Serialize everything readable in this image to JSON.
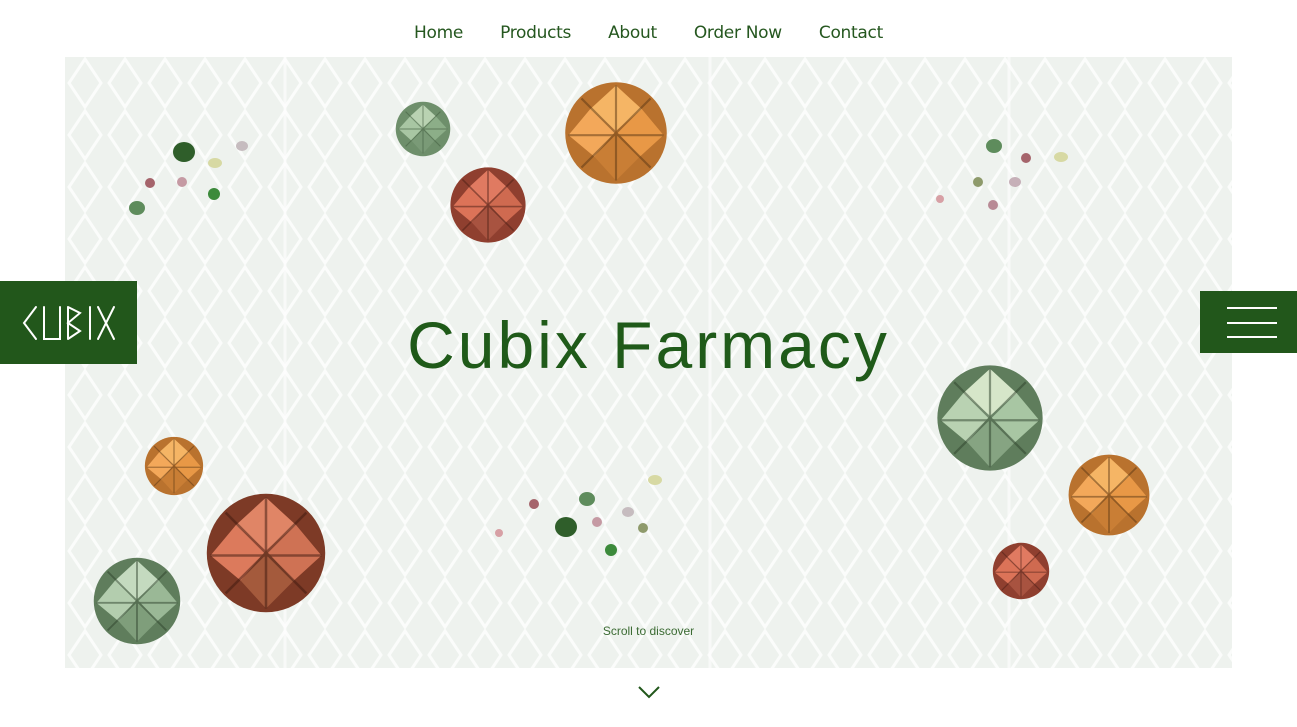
{
  "nav": {
    "items": [
      {
        "label": "Home"
      },
      {
        "label": "Products"
      },
      {
        "label": "About"
      },
      {
        "label": "Order Now"
      },
      {
        "label": "Contact"
      }
    ]
  },
  "logo": {
    "text": "CUBIX"
  },
  "hero": {
    "title": "Cubix Farmacy",
    "scroll_hint": "Scroll to discover"
  },
  "icons": {
    "menu": "hamburger-menu-icon",
    "scroll": "chevron-down-icon"
  },
  "colors": {
    "brand_green": "#22571b",
    "title_green": "#1f5a19",
    "hero_bg": "#eef2ee",
    "ball_orange": "#f2a655",
    "ball_red": "#d86a52",
    "ball_sage": "#8fb08b"
  }
}
